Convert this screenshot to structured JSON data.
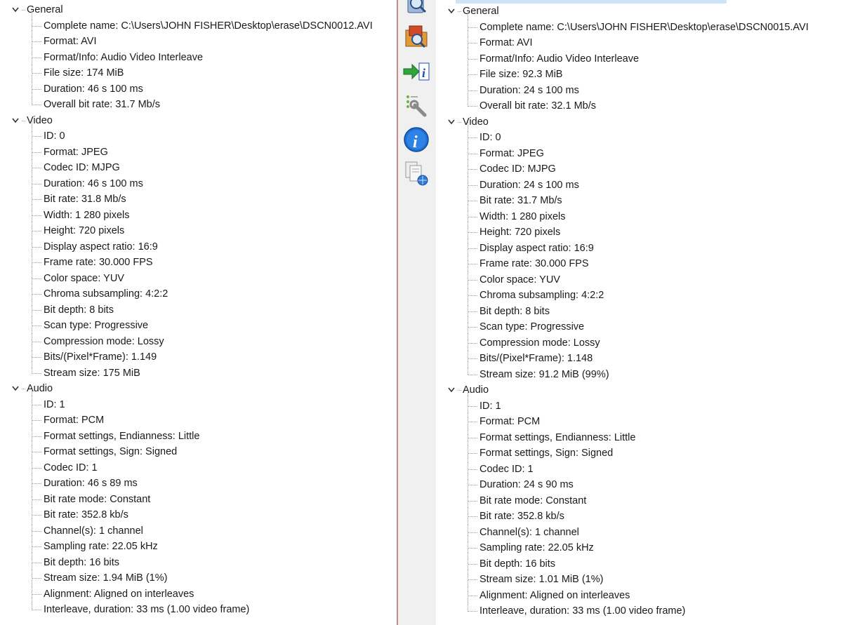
{
  "left": {
    "sections": [
      {
        "title": "General",
        "items": [
          "Complete name: C:\\Users\\JOHN FISHER\\Desktop\\erase\\DSCN0012.AVI",
          "Format: AVI",
          "Format/Info: Audio Video Interleave",
          "File size: 174 MiB",
          "Duration: 46 s 100 ms",
          "Overall bit rate: 31.7 Mb/s"
        ]
      },
      {
        "title": "Video",
        "items": [
          "ID: 0",
          "Format: JPEG",
          "Codec ID: MJPG",
          "Duration: 46 s 100 ms",
          "Bit rate: 31.8 Mb/s",
          "Width: 1 280 pixels",
          "Height: 720 pixels",
          "Display aspect ratio: 16:9",
          "Frame rate: 30.000 FPS",
          "Color space: YUV",
          "Chroma subsampling: 4:2:2",
          "Bit depth: 8 bits",
          "Scan type: Progressive",
          "Compression mode: Lossy",
          "Bits/(Pixel*Frame): 1.149",
          "Stream size: 175 MiB"
        ]
      },
      {
        "title": "Audio",
        "items": [
          "ID: 1",
          "Format: PCM",
          "Format settings, Endianness: Little",
          "Format settings, Sign: Signed",
          "Codec ID: 1",
          "Duration: 46 s 89 ms",
          "Bit rate mode: Constant",
          "Bit rate: 352.8 kb/s",
          "Channel(s): 1 channel",
          "Sampling rate: 22.05 kHz",
          "Bit depth: 16 bits",
          "Stream size: 1.94 MiB (1%)",
          "Alignment: Aligned on interleaves",
          "Interleave, duration: 33  ms (1.00 video frame)"
        ]
      }
    ]
  },
  "right": {
    "sections": [
      {
        "title": "General",
        "items": [
          "Complete name: C:\\Users\\JOHN FISHER\\Desktop\\erase\\DSCN0015.AVI",
          "Format: AVI",
          "Format/Info: Audio Video Interleave",
          "File size: 92.3 MiB",
          "Duration: 24 s 100 ms",
          "Overall bit rate: 32.1 Mb/s"
        ]
      },
      {
        "title": "Video",
        "items": [
          "ID: 0",
          "Format: JPEG",
          "Codec ID: MJPG",
          "Duration: 24 s 100 ms",
          "Bit rate: 31.7 Mb/s",
          "Width: 1 280 pixels",
          "Height: 720 pixels",
          "Display aspect ratio: 16:9",
          "Frame rate: 30.000 FPS",
          "Color space: YUV",
          "Chroma subsampling: 4:2:2",
          "Bit depth: 8 bits",
          "Scan type: Progressive",
          "Compression mode: Lossy",
          "Bits/(Pixel*Frame): 1.148",
          "Stream size: 91.2 MiB (99%)"
        ]
      },
      {
        "title": "Audio",
        "items": [
          "ID: 1",
          "Format: PCM",
          "Format settings, Endianness: Little",
          "Format settings, Sign: Signed",
          "Codec ID: 1",
          "Duration: 24 s 90 ms",
          "Bit rate mode: Constant",
          "Bit rate: 352.8 kb/s",
          "Channel(s): 1 channel",
          "Sampling rate: 22.05 kHz",
          "Bit depth: 16 bits",
          "Stream size: 1.01 MiB (1%)",
          "Alignment: Aligned on interleaves",
          "Interleave, duration: 33  ms (1.00 video frame)"
        ]
      }
    ]
  },
  "toolbar": {
    "buttons": [
      {
        "name": "magnifier-file-icon"
      },
      {
        "name": "folder-search-icon"
      },
      {
        "name": "import-info-icon"
      },
      {
        "name": "settings-wrench-icon"
      },
      {
        "name": "about-info-icon"
      },
      {
        "name": "documents-web-icon"
      }
    ]
  },
  "colors": {
    "tree_line": "#9a9a9a",
    "info_blue": "#1f6fd1",
    "splitter": "#c98a8a",
    "selection": "#cfe3f7"
  }
}
